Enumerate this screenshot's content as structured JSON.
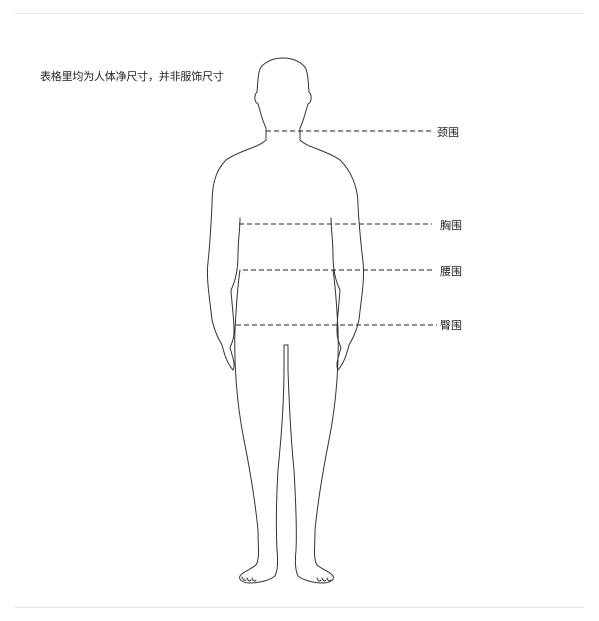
{
  "note": "表格里均为人体净尺寸，并非服饰尺寸",
  "measurements": {
    "neck": "颈围",
    "chest": "胸围",
    "waist": "腰围",
    "hip": "臀围"
  },
  "colors": {
    "outline": "#333333",
    "divider": "#e6e6e6",
    "text": "#222222"
  }
}
